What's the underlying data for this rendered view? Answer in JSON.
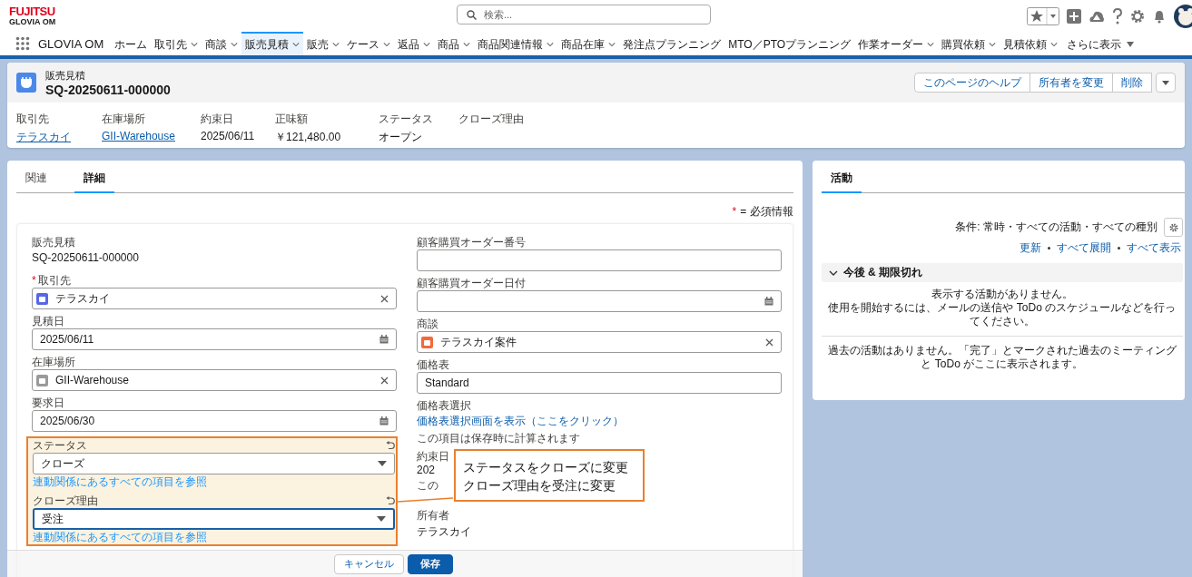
{
  "brand": {
    "company": "FUJITSU",
    "product": "GLOVIA OM"
  },
  "search": {
    "placeholder": "検索..."
  },
  "app_name": "GLOVIA OM",
  "nav_tabs": [
    {
      "label": "ホーム",
      "kind": "tab",
      "menu": false,
      "selected": false
    },
    {
      "label": "取引先",
      "kind": "tab",
      "menu": true,
      "selected": false
    },
    {
      "label": "商談",
      "kind": "tab",
      "menu": true,
      "selected": false
    },
    {
      "label": "販売見積",
      "kind": "tab",
      "menu": true,
      "selected": true
    },
    {
      "label": "販売",
      "kind": "tab",
      "menu": true,
      "selected": false
    },
    {
      "label": "ケース",
      "kind": "tab",
      "menu": true,
      "selected": false
    },
    {
      "label": "返品",
      "kind": "tab",
      "menu": true,
      "selected": false
    },
    {
      "label": "商品",
      "kind": "tab",
      "menu": true,
      "selected": false
    },
    {
      "label": "商品関連情報",
      "kind": "tab",
      "menu": true,
      "selected": false
    },
    {
      "label": "商品在庫",
      "kind": "tab",
      "menu": true,
      "selected": false
    },
    {
      "label": "発注点プランニング",
      "kind": "tab",
      "menu": false,
      "selected": false
    },
    {
      "label": "MTO／PTOプランニング",
      "kind": "tab",
      "menu": false,
      "selected": false
    },
    {
      "label": "作業オーダー",
      "kind": "tab",
      "menu": true,
      "selected": false
    },
    {
      "label": "購買依頼",
      "kind": "tab",
      "menu": true,
      "selected": false
    },
    {
      "label": "見積依頼",
      "kind": "tab",
      "menu": true,
      "selected": false
    },
    {
      "label": "さらに表示",
      "kind": "more",
      "menu": true,
      "selected": false
    }
  ],
  "record": {
    "object_label": "販売見積",
    "title": "SQ-20250611-000000",
    "actions": [
      "このページのヘルプ",
      "所有者を変更",
      "削除"
    ],
    "highlights": [
      {
        "label": "取引先",
        "value": "テラスカイ",
        "link": true
      },
      {
        "label": "在庫場所",
        "value": "GII-Warehouse",
        "link": true
      },
      {
        "label": "約束日",
        "value": "2025/06/11",
        "link": false
      },
      {
        "label": "正味額",
        "value": "￥121,480.00",
        "link": false
      },
      {
        "label": "ステータス",
        "value": "オープン",
        "link": false
      },
      {
        "label": "クローズ理由"
      }
    ]
  },
  "detail_tabs": [
    {
      "label": "関連",
      "selected": false
    },
    {
      "label": "詳細",
      "selected": true
    }
  ],
  "required_note": {
    "mark": "*",
    "text": "= 必須情報"
  },
  "left_fields": [
    {
      "kind": "readonly",
      "label": "販売見積",
      "value": "SQ-20250611-000000"
    },
    {
      "kind": "lookup",
      "label": "取引先",
      "value": "テラスカイ",
      "required": true,
      "color": "#5867e8"
    },
    {
      "kind": "date",
      "label": "見積日",
      "value": "2025/06/11"
    },
    {
      "kind": "lookup",
      "label": "在庫場所",
      "value": "GII-Warehouse",
      "color": "#9a9a9a"
    },
    {
      "kind": "date",
      "label": "要求日",
      "value": "2025/06/30"
    },
    {
      "kind": "picklist",
      "label": "ステータス",
      "value": "クローズ",
      "hint": "連動関係にあるすべての項目を参照",
      "edited": true,
      "focused": false
    },
    {
      "kind": "picklist",
      "label": "クローズ理由",
      "value": "受注",
      "hint": "連動関係にあるすべての項目を参照",
      "edited": true,
      "focused": true
    }
  ],
  "right_fields": [
    {
      "kind": "text",
      "label": "顧客購買オーダー番号"
    },
    {
      "kind": "date",
      "label": "顧客購買オーダー日付"
    },
    {
      "kind": "lookup",
      "label": "商談",
      "value": "テラスカイ案件",
      "color": "#f26a3c"
    },
    {
      "kind": "text",
      "label": "価格表",
      "value": "Standard"
    },
    {
      "kind": "link",
      "label": "価格表選択",
      "value": "価格表選択画面を表示（ここをクリック）",
      "note": "この項目は保存時に計算されます"
    },
    {
      "kind": "readonly",
      "label": "約束日",
      "value": "202",
      "note": "この"
    },
    {
      "kind": "readonly",
      "label": "所有者",
      "value": "テラスカイ"
    }
  ],
  "footer_buttons": [
    {
      "label": "キャンセル",
      "kind": "neutral"
    },
    {
      "label": "保存",
      "kind": "brand"
    }
  ],
  "callout": {
    "lines": [
      "ステータスをクローズに変更",
      "クローズ理由を受注に変更"
    ]
  },
  "activity": {
    "tab": {
      "label": "活動",
      "selected": true
    },
    "filter": "条件: 常時・すべての活動・すべての種別",
    "links": [
      "更新",
      "すべて展開",
      "すべて表示"
    ],
    "section": {
      "title": "今後 & 期限切れ",
      "expanded": true
    },
    "empty_lines": [
      "表示する活動がありません。",
      "使用を開始するには、メールの送信や ToDo のスケジュールなどを行ってください。"
    ],
    "past": "過去の活動はありません。「完了」とマークされた過去のミーティングと ToDo がここに表示されます。"
  }
}
